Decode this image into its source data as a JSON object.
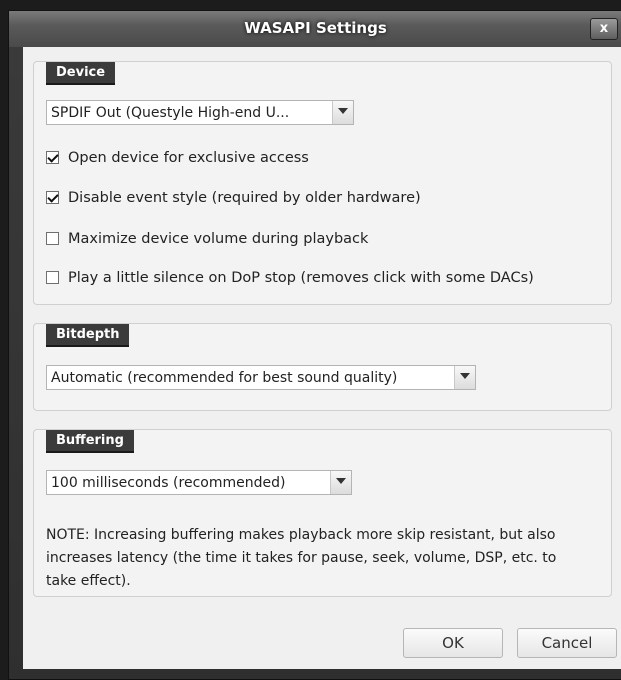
{
  "window": {
    "title": "WASAPI Settings",
    "close_label": "x"
  },
  "device": {
    "label": "Device",
    "selected": "SPDIF Out (Questyle High-end U...",
    "checkboxes": [
      {
        "label": "Open device for exclusive access",
        "checked": true
      },
      {
        "label": "Disable event style (required by older hardware)",
        "checked": true
      },
      {
        "label": "Maximize device volume during playback",
        "checked": false
      },
      {
        "label": "Play a little silence on DoP stop (removes click with some DACs)",
        "checked": false
      }
    ]
  },
  "bitdepth": {
    "label": "Bitdepth",
    "selected": "Automatic (recommended for best sound quality)"
  },
  "buffering": {
    "label": "Buffering",
    "selected": "100 milliseconds (recommended)",
    "note": "NOTE: Increasing buffering makes playback more skip resistant, but also increases latency (the time it takes for pause, seek, volume, DSP, etc. to take effect)."
  },
  "buttons": {
    "ok": "OK",
    "cancel": "Cancel"
  }
}
